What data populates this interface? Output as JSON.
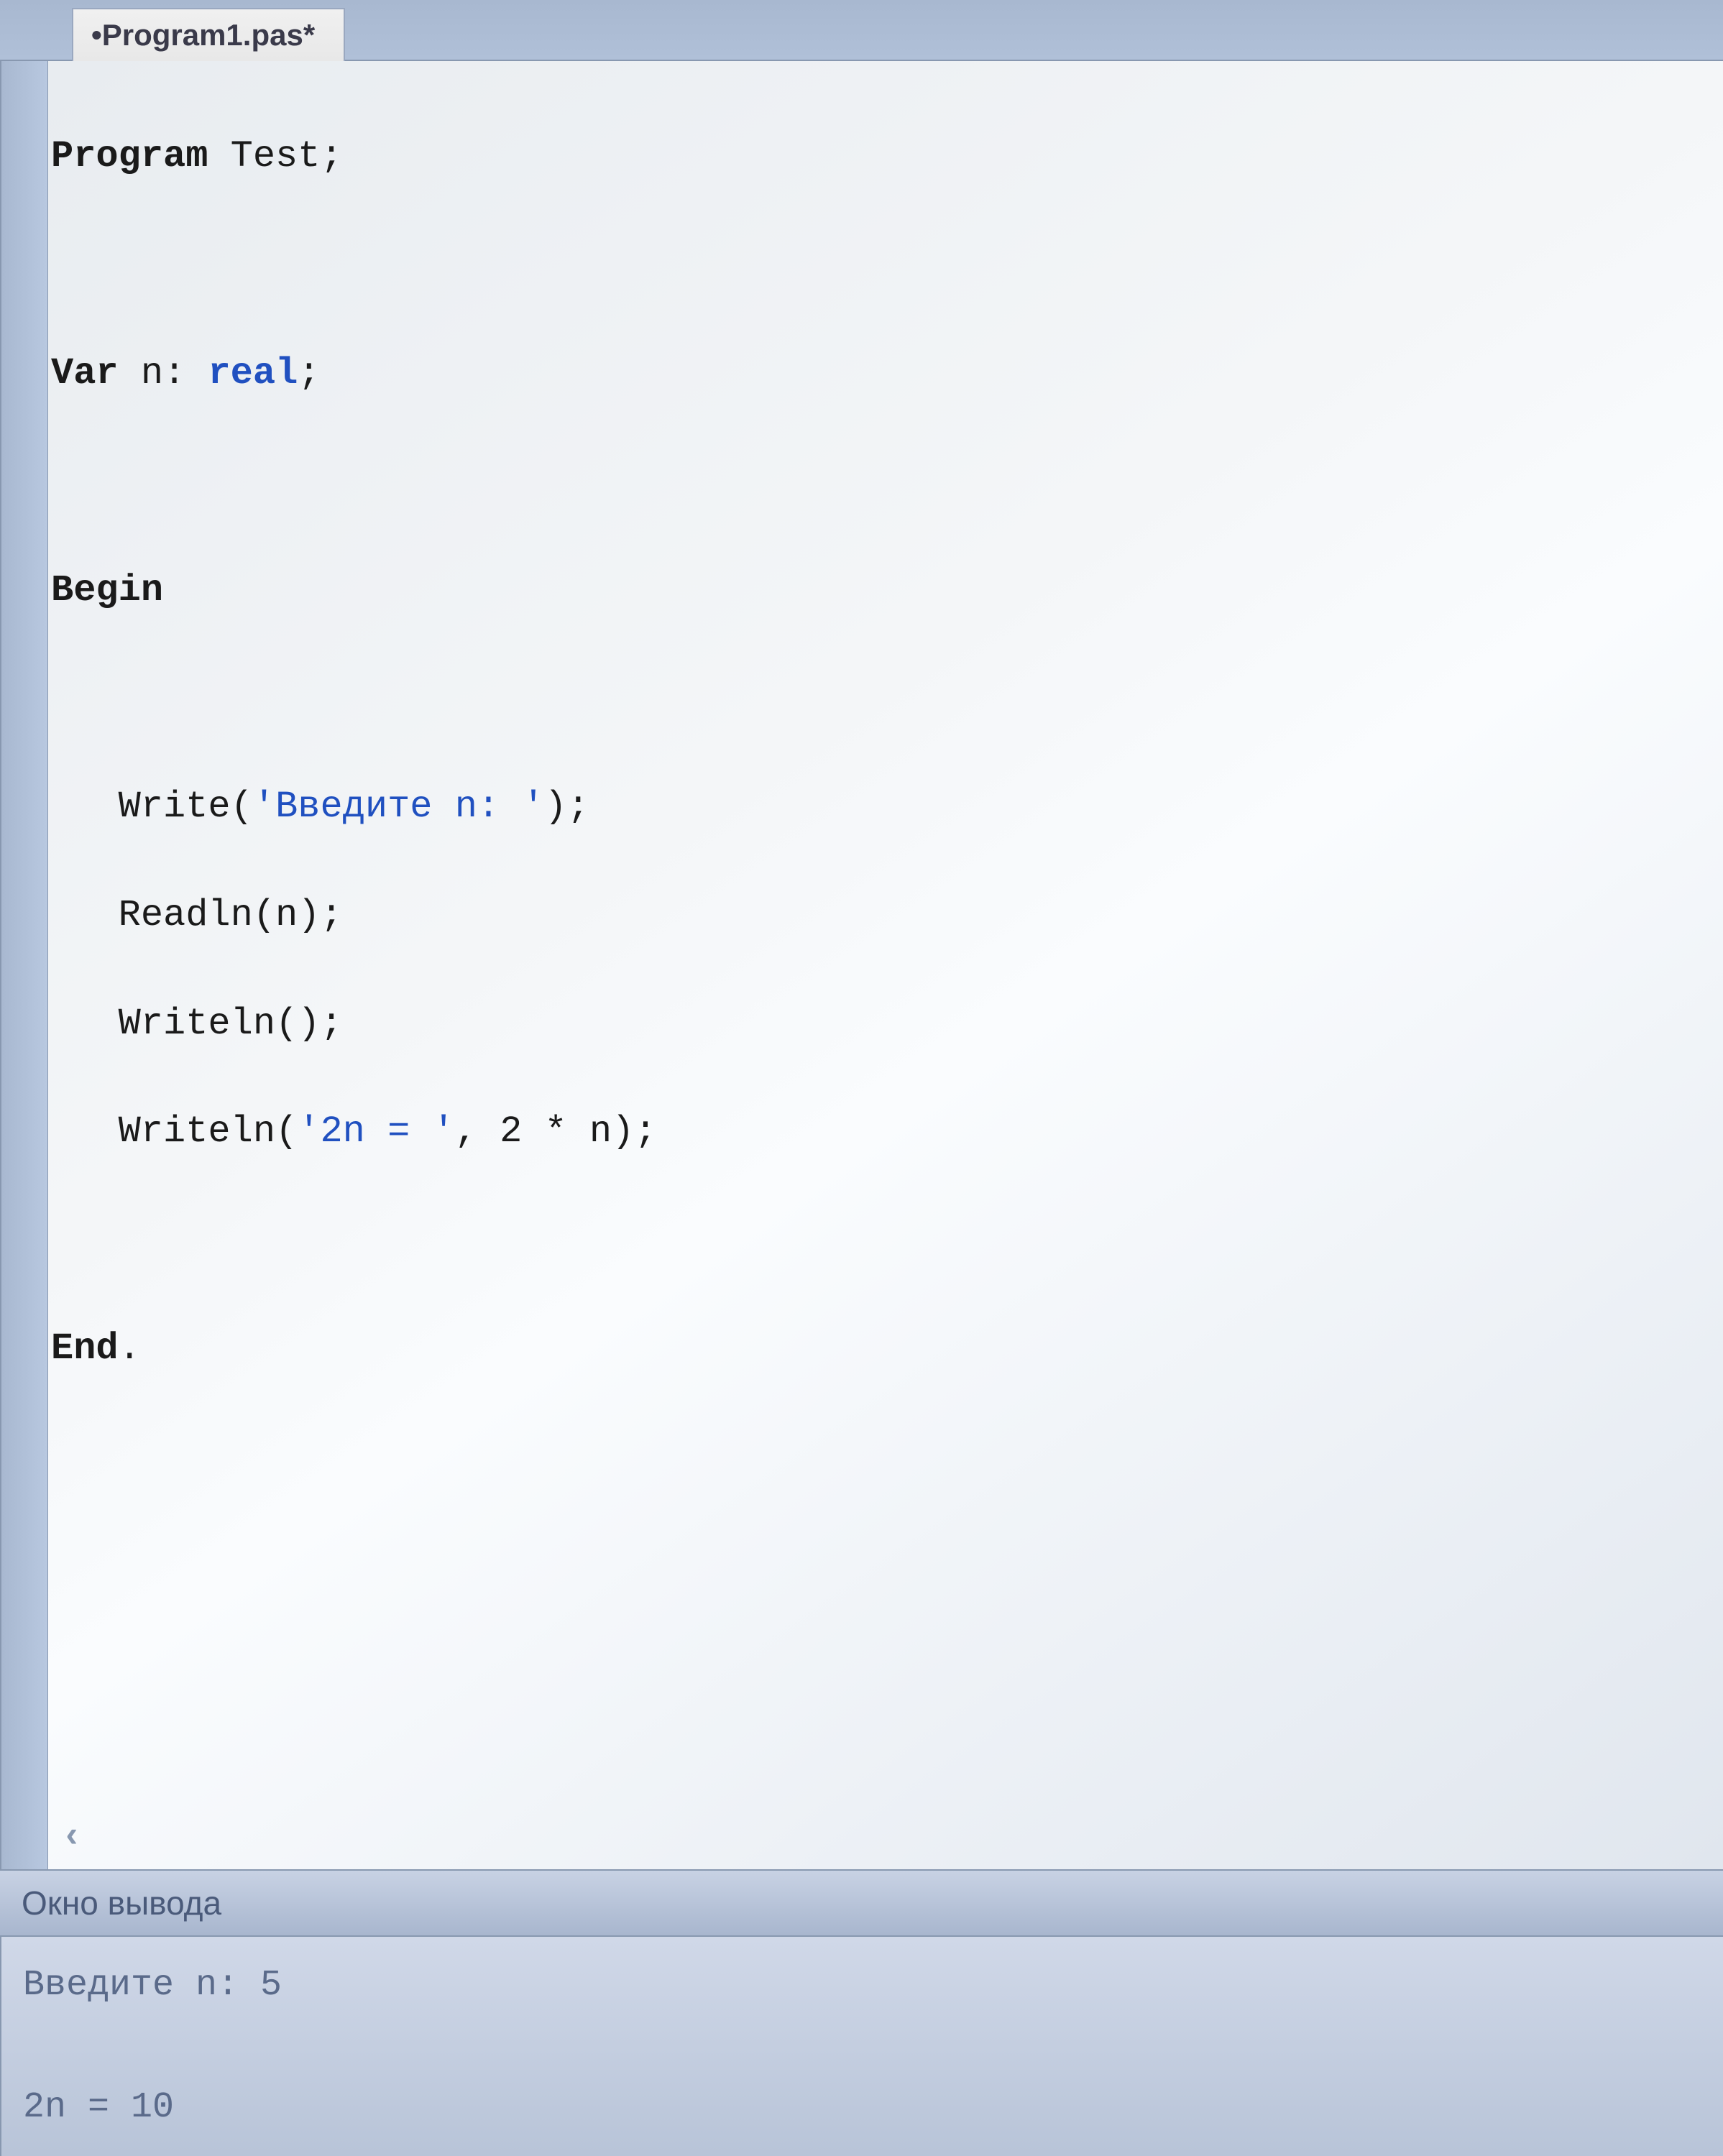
{
  "tab": {
    "label": "•Program1.pas*"
  },
  "code": {
    "l1_kw": "Program",
    "l1_rest": " Test;",
    "l3_kw": "Var",
    "l3_mid": " n: ",
    "l3_type": "real",
    "l3_end": ";",
    "l5_kw": "Begin",
    "l7_a": "   Write(",
    "l7_str": "'Введите n: '",
    "l7_b": ");",
    "l8": "   Readln(n);",
    "l9": "   Writeln();",
    "l10_a": "   Writeln(",
    "l10_str": "'2n = '",
    "l10_b": ", 2 * n);",
    "l12_kw": "End",
    "l12_end": "."
  },
  "scroll_glyph": "‹",
  "output": {
    "title": "Окно вывода",
    "line1": "Введите n: 5",
    "line2": "",
    "line3": "2n = 10"
  }
}
